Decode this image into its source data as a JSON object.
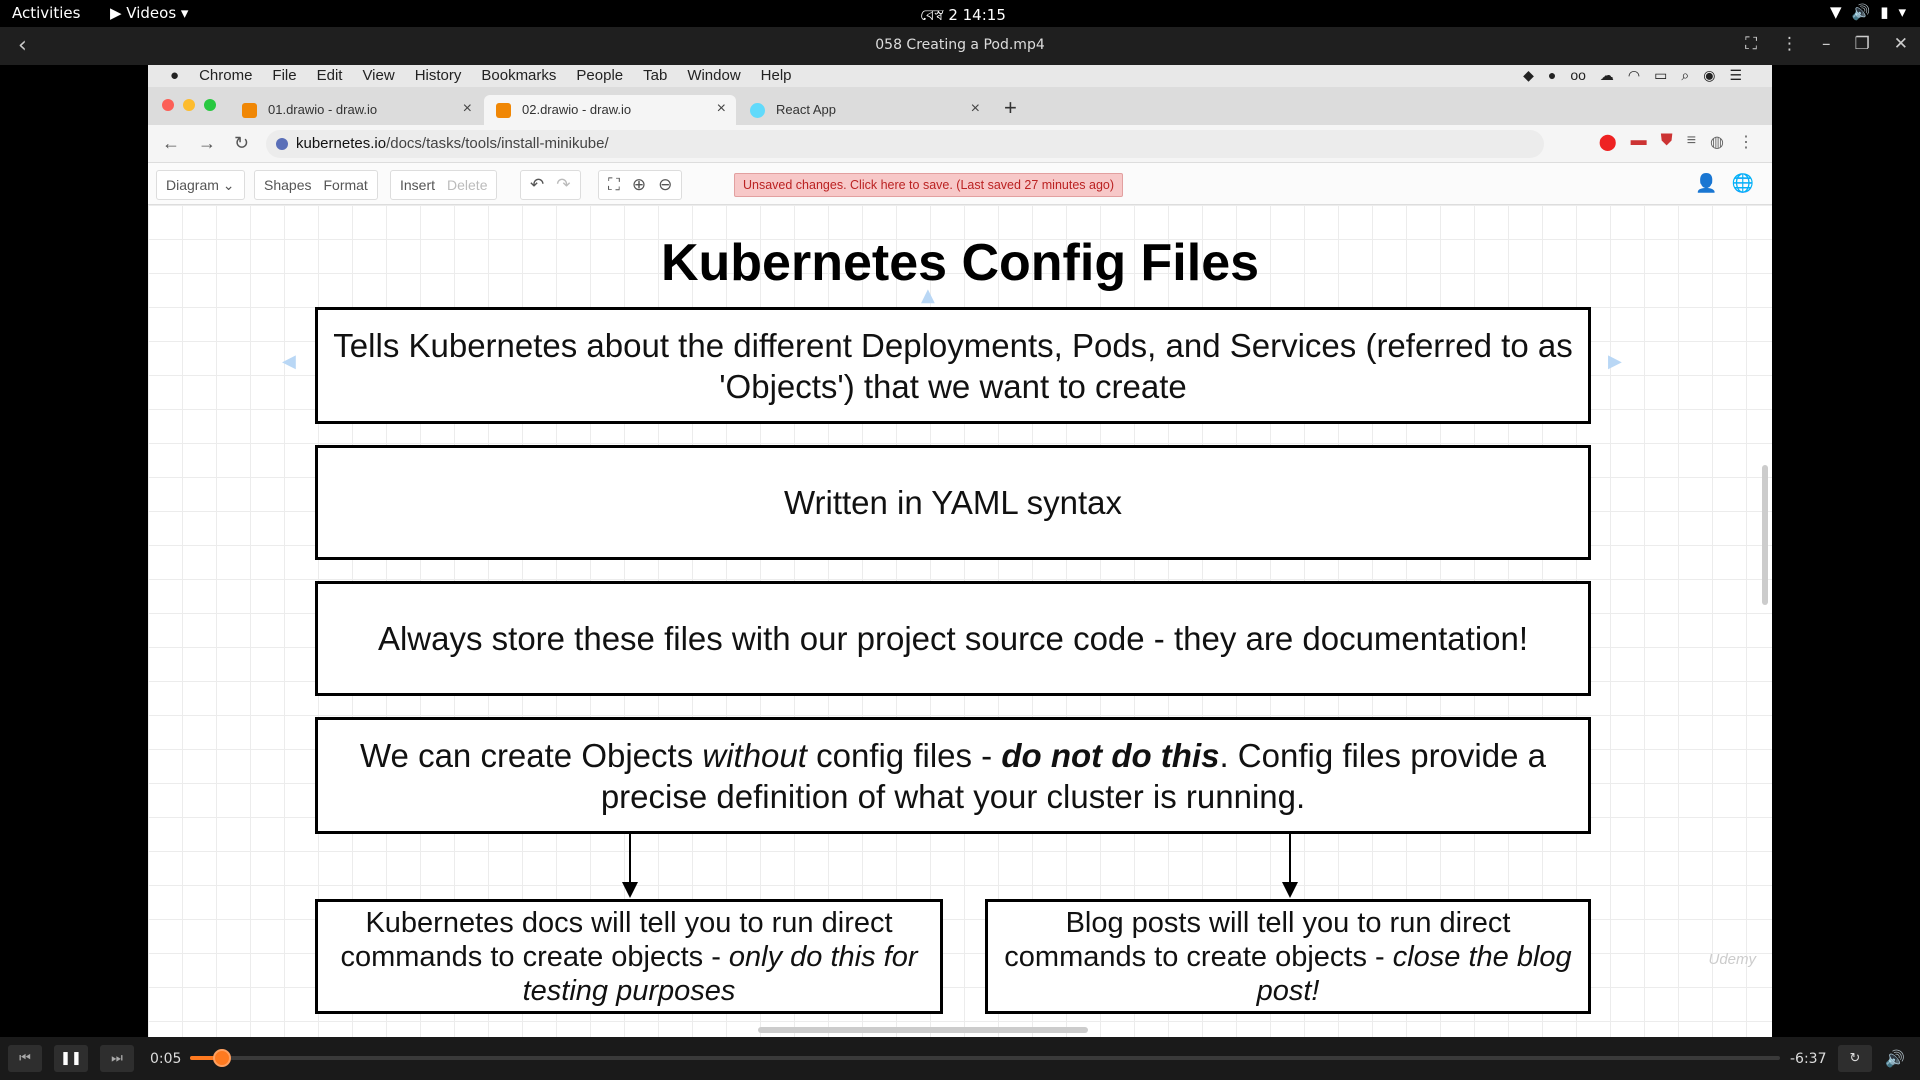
{
  "system_bar": {
    "activities": "Activities",
    "app_menu": "▶ Videos ▾",
    "clock": "বেস্ব 2  14:15",
    "tray_icons": [
      "wifi-icon",
      "volume-icon",
      "battery-icon",
      "chevron-down-icon"
    ]
  },
  "player": {
    "title": "058 Creating a Pod.mp4",
    "elapsed": "0:05",
    "remaining": "-6:37",
    "progress_fraction": 0.013
  },
  "mac_menubar": {
    "items": [
      "Chrome",
      "File",
      "Edit",
      "View",
      "History",
      "Bookmarks",
      "People",
      "Tab",
      "Window",
      "Help"
    ]
  },
  "browser": {
    "tabs": [
      {
        "label": "01.drawio - draw.io",
        "active": false,
        "favicon_color": "#f08705"
      },
      {
        "label": "02.drawio - draw.io",
        "active": true,
        "favicon_color": "#f08705"
      },
      {
        "label": "React App",
        "active": false,
        "favicon_color": "#61dafb"
      }
    ],
    "url_host": "kubernetes.io",
    "url_path": "/docs/tasks/tools/install-minikube/"
  },
  "drawio": {
    "diagram_label": "Diagram ⌄",
    "shapes_label": "Shapes",
    "format_label": "Format",
    "insert_label": "Insert",
    "delete_label": "Delete",
    "unsaved_notice": "Unsaved changes. Click here to save. (Last saved 27 minutes ago)"
  },
  "diagram": {
    "title": "Kubernetes Config Files",
    "box1": "Tells Kubernetes about the different Deployments, Pods, and Services (referred to as 'Objects') that we want to create",
    "box2": "Written in YAML syntax",
    "box3": "Always store these files with our project source code - they are documentation!",
    "box4_a": "We can create Objects ",
    "box4_b": "without",
    "box4_c": " config files - ",
    "box4_d": "do not do this",
    "box4_e": ".  Config files provide a precise definition of what your cluster is running.",
    "box5_a": "Kubernetes docs will tell you to run direct commands to create objects - ",
    "box5_b": "only do this for testing purposes",
    "box6_a": "Blog posts will tell you to run direct commands to create objects - ",
    "box6_b": "close the blog post!"
  },
  "colors": {
    "progress": "#ff7a20",
    "unsaved_bg": "#f7c8c8",
    "unsaved_text": "#b22222"
  }
}
